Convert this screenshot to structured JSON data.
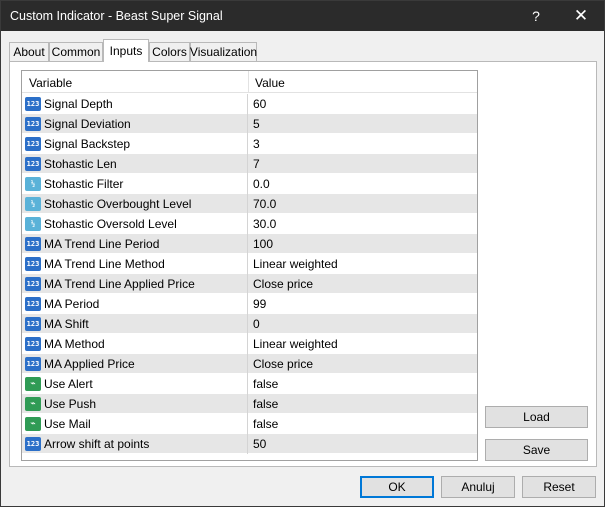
{
  "window": {
    "title": "Custom Indicator - Beast Super Signal",
    "help_glyph": "?",
    "close_glyph": "✕"
  },
  "tabs": [
    {
      "label": "About"
    },
    {
      "label": "Common"
    },
    {
      "label": "Inputs",
      "active": true
    },
    {
      "label": "Colors"
    },
    {
      "label": "Visualization"
    }
  ],
  "grid": {
    "headers": {
      "variable": "Variable",
      "value": "Value"
    },
    "rows": [
      {
        "type": "int",
        "icon": "int-type-icon",
        "name": "Signal Depth",
        "value": "60"
      },
      {
        "type": "int",
        "icon": "int-type-icon",
        "name": "Signal Deviation",
        "value": "5"
      },
      {
        "type": "int",
        "icon": "int-type-icon",
        "name": "Signal Backstep",
        "value": "3"
      },
      {
        "type": "int",
        "icon": "int-type-icon",
        "name": "Stohastic Len",
        "value": "7"
      },
      {
        "type": "dbl",
        "icon": "double-type-icon",
        "name": "Stohastic Filter",
        "value": "0.0"
      },
      {
        "type": "dbl",
        "icon": "double-type-icon",
        "name": "Stohastic Overbought Level",
        "value": "70.0"
      },
      {
        "type": "dbl",
        "icon": "double-type-icon",
        "name": "Stohastic Oversold Level",
        "value": "30.0"
      },
      {
        "type": "int",
        "icon": "int-type-icon",
        "name": "MA Trend Line Period",
        "value": "100"
      },
      {
        "type": "int",
        "icon": "int-type-icon",
        "name": "MA Trend Line Method",
        "value": "Linear weighted"
      },
      {
        "type": "int",
        "icon": "int-type-icon",
        "name": "MA Trend Line Applied Price",
        "value": "Close price"
      },
      {
        "type": "int",
        "icon": "int-type-icon",
        "name": "MA Period",
        "value": "99"
      },
      {
        "type": "int",
        "icon": "int-type-icon",
        "name": "MA Shift",
        "value": "0"
      },
      {
        "type": "int",
        "icon": "int-type-icon",
        "name": "MA Method",
        "value": "Linear weighted"
      },
      {
        "type": "int",
        "icon": "int-type-icon",
        "name": "MA Applied Price",
        "value": "Close price"
      },
      {
        "type": "bool",
        "icon": "bool-type-icon",
        "name": "Use Alert",
        "value": "false"
      },
      {
        "type": "bool",
        "icon": "bool-type-icon",
        "name": "Use Push",
        "value": "false"
      },
      {
        "type": "bool",
        "icon": "bool-type-icon",
        "name": "Use Mail",
        "value": "false"
      },
      {
        "type": "int",
        "icon": "int-type-icon",
        "name": "Arrow shift at points",
        "value": "50"
      }
    ]
  },
  "side_buttons": {
    "load": "Load",
    "save": "Save"
  },
  "footer_buttons": {
    "ok": "OK",
    "cancel": "Anuluj",
    "reset": "Reset"
  }
}
